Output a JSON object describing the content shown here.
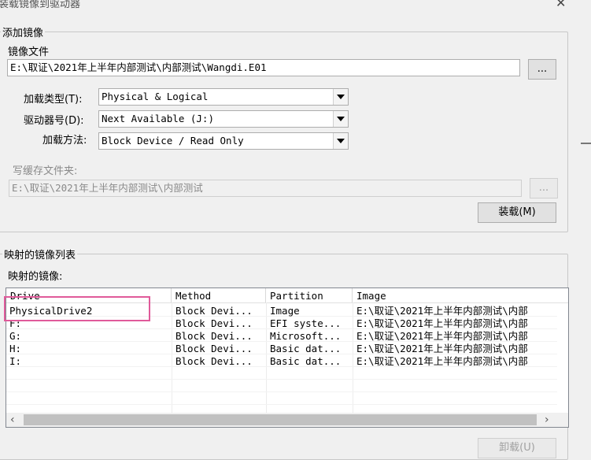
{
  "window": {
    "title": "装载镜像到驱动器"
  },
  "add_image": {
    "legend": "添加镜像",
    "file_label": "镜像文件",
    "file_value": "E:\\取证\\2021年上半年内部测试\\内部测试\\Wangdi.E01",
    "browse_label": "...",
    "mount_type_label": "加载类型(T):",
    "mount_type_value": "Physical & Logical",
    "drive_letter_label": "驱动器号(D):",
    "drive_letter_value": "Next Available (J:)",
    "mount_method_label": "加载方法:",
    "mount_method_value": "Block Device / Read Only",
    "cache_label": "写缓存文件夹:",
    "cache_value": "E:\\取证\\2021年上半年内部测试\\内部测试",
    "cache_browse_label": "...",
    "mount_button": "装载(M)"
  },
  "mapped": {
    "legend": "映射的镜像列表",
    "list_label": "映射的镜像:",
    "columns": [
      "Drive",
      "Method",
      "Partition",
      "Image"
    ],
    "rows": [
      {
        "drive": "PhysicalDrive2",
        "method": "Block Devi...",
        "partition": "Image",
        "image": "E:\\取证\\2021年上半年内部测试\\内部"
      },
      {
        "drive": "F:",
        "method": "Block Devi...",
        "partition": "EFI syste...",
        "image": "E:\\取证\\2021年上半年内部测试\\内部"
      },
      {
        "drive": "G:",
        "method": "Block Devi...",
        "partition": "Microsoft...",
        "image": "E:\\取证\\2021年上半年内部测试\\内部"
      },
      {
        "drive": "H:",
        "method": "Block Devi...",
        "partition": "Basic dat...",
        "image": "E:\\取证\\2021年上半年内部测试\\内部"
      },
      {
        "drive": "I:",
        "method": "Block Devi...",
        "partition": "Basic dat...",
        "image": "E:\\取证\\2021年上半年内部测试\\内部"
      }
    ],
    "unmount_button": "卸载(U)"
  },
  "colors": {
    "highlight": "#e05a9a"
  }
}
